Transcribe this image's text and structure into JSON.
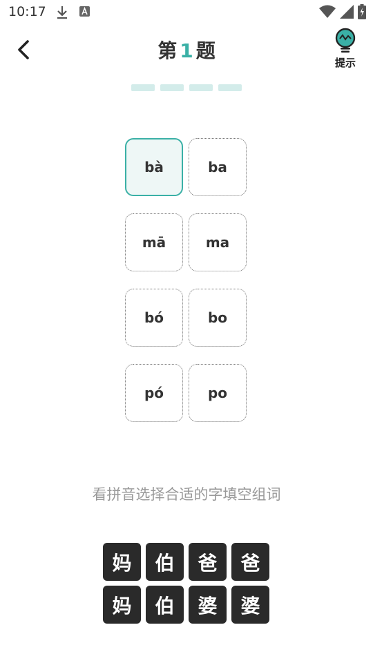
{
  "status": {
    "time": "10:17"
  },
  "header": {
    "title_prefix": "第",
    "title_number": "1",
    "title_suffix": "题",
    "hint_label": "提示"
  },
  "progress": {
    "segments": 4
  },
  "colors": {
    "accent": "#3ab0a6",
    "progress": "#d3ecea",
    "char_button": "#2a2a2a"
  },
  "pinyin_cells": [
    {
      "label": "bà",
      "selected": true
    },
    {
      "label": "ba",
      "selected": false
    },
    {
      "label": "mā",
      "selected": false
    },
    {
      "label": "ma",
      "selected": false
    },
    {
      "label": "bó",
      "selected": false
    },
    {
      "label": "bo",
      "selected": false
    },
    {
      "label": "pó",
      "selected": false
    },
    {
      "label": "po",
      "selected": false
    }
  ],
  "instruction": "看拼音选择合适的字填空组词",
  "characters": [
    "妈",
    "伯",
    "爸",
    "爸",
    "妈",
    "伯",
    "婆",
    "婆"
  ]
}
